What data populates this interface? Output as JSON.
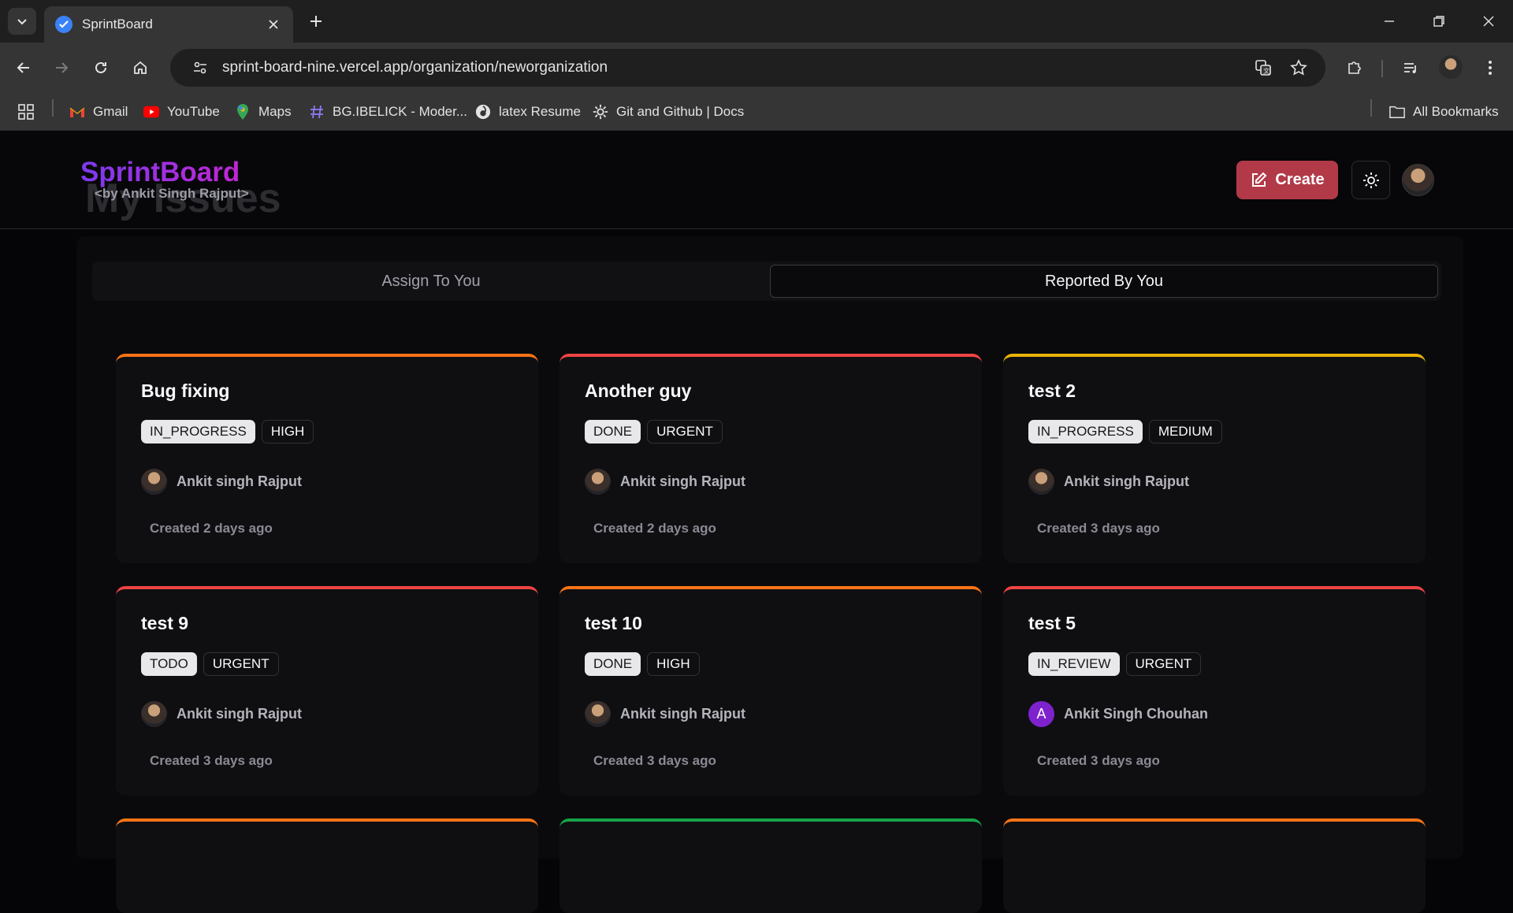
{
  "browser": {
    "tab_title": "SprintBoard",
    "url": "sprint-board-nine.vercel.app/organization/neworganization",
    "bookmarks": [
      {
        "label": "Gmail",
        "icon": "gmail-icon"
      },
      {
        "label": "YouTube",
        "icon": "youtube-icon"
      },
      {
        "label": "Maps",
        "icon": "maps-icon"
      },
      {
        "label": "BG.IBELICK - Moder...",
        "icon": "hash-icon"
      },
      {
        "label": "latex Resume",
        "icon": "overleaf-icon"
      },
      {
        "label": "Git and Github | Docs",
        "icon": "gear-icon"
      }
    ],
    "all_bookmarks_label": "All Bookmarks"
  },
  "header": {
    "brand": "SprintBoard",
    "brand_sub": "<by Ankit Singh Rajput>",
    "ghost_title": "My Issues",
    "create_label": "Create"
  },
  "tabs": {
    "assign_label": "Assign To You",
    "reported_label": "Reported By You",
    "active": "reported"
  },
  "colors": {
    "accent_create": "#b23a48",
    "urgent": "#ef4444",
    "high": "#f97316",
    "medium": "#eab308",
    "low": "#22c55e"
  },
  "issues": [
    {
      "title": "Bug fixing",
      "status": "IN_PROGRESS",
      "priority": "HIGH",
      "assignee": "Ankit singh Rajput",
      "created": "Created 2 days ago",
      "avatar": "photo"
    },
    {
      "title": "Another guy",
      "status": "DONE",
      "priority": "URGENT",
      "assignee": "Ankit singh Rajput",
      "created": "Created 2 days ago",
      "avatar": "photo"
    },
    {
      "title": "test 2",
      "status": "IN_PROGRESS",
      "priority": "MEDIUM",
      "assignee": "Ankit singh Rajput",
      "created": "Created 3 days ago",
      "avatar": "photo"
    },
    {
      "title": "test 9",
      "status": "TODO",
      "priority": "URGENT",
      "assignee": "Ankit singh Rajput",
      "created": "Created 3 days ago",
      "avatar": "photo"
    },
    {
      "title": "test 10",
      "status": "DONE",
      "priority": "HIGH",
      "assignee": "Ankit singh Rajput",
      "created": "Created 3 days ago",
      "avatar": "photo"
    },
    {
      "title": "test 5",
      "status": "IN_REVIEW",
      "priority": "URGENT",
      "assignee": "Ankit Singh Chouhan",
      "created": "Created 3 days ago",
      "avatar": "A"
    }
  ],
  "partial_cards": [
    {
      "accent": "#f97316"
    },
    {
      "accent": "#16a34a"
    },
    {
      "accent": "#f97316"
    }
  ]
}
